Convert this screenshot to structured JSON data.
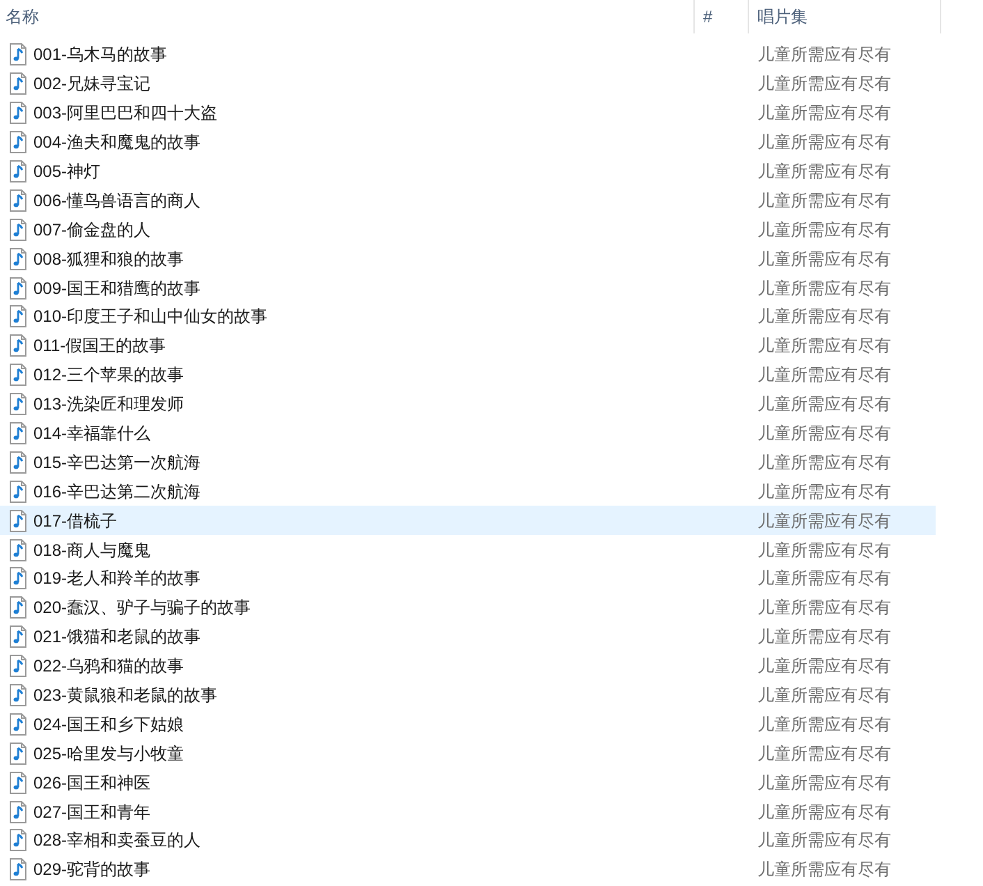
{
  "table": {
    "columns": [
      "名称",
      "#",
      "唱片集"
    ],
    "rows": [
      {
        "name": "001-乌木马的故事",
        "album": "儿童所需应有尽有",
        "selected": false
      },
      {
        "name": "002-兄妹寻宝记",
        "album": "儿童所需应有尽有",
        "selected": false
      },
      {
        "name": "003-阿里巴巴和四十大盗",
        "album": "儿童所需应有尽有",
        "selected": false
      },
      {
        "name": "004-渔夫和魔鬼的故事",
        "album": "儿童所需应有尽有",
        "selected": false
      },
      {
        "name": "005-神灯",
        "album": "儿童所需应有尽有",
        "selected": false
      },
      {
        "name": "006-懂鸟兽语言的商人",
        "album": "儿童所需应有尽有",
        "selected": false
      },
      {
        "name": "007-偷金盘的人",
        "album": "儿童所需应有尽有",
        "selected": false
      },
      {
        "name": "008-狐狸和狼的故事",
        "album": "儿童所需应有尽有",
        "selected": false
      },
      {
        "name": "009-国王和猎鹰的故事",
        "album": "儿童所需应有尽有",
        "selected": false
      },
      {
        "name": "010-印度王子和山中仙女的故事",
        "album": "儿童所需应有尽有",
        "selected": false
      },
      {
        "name": "011-假国王的故事",
        "album": "儿童所需应有尽有",
        "selected": false
      },
      {
        "name": "012-三个苹果的故事",
        "album": "儿童所需应有尽有",
        "selected": false
      },
      {
        "name": "013-洗染匠和理发师",
        "album": "儿童所需应有尽有",
        "selected": false
      },
      {
        "name": "014-幸福靠什么",
        "album": "儿童所需应有尽有",
        "selected": false
      },
      {
        "name": "015-辛巴达第一次航海",
        "album": "儿童所需应有尽有",
        "selected": false
      },
      {
        "name": "016-辛巴达第二次航海",
        "album": "儿童所需应有尽有",
        "selected": false
      },
      {
        "name": "017-借梳子",
        "album": "儿童所需应有尽有",
        "selected": true
      },
      {
        "name": "018-商人与魔鬼",
        "album": "儿童所需应有尽有",
        "selected": false
      },
      {
        "name": "019-老人和羚羊的故事",
        "album": "儿童所需应有尽有",
        "selected": false
      },
      {
        "name": "020-蠢汉、驴子与骗子的故事",
        "album": "儿童所需应有尽有",
        "selected": false
      },
      {
        "name": "021-饿猫和老鼠的故事",
        "album": "儿童所需应有尽有",
        "selected": false
      },
      {
        "name": "022-乌鸦和猫的故事",
        "album": "儿童所需应有尽有",
        "selected": false
      },
      {
        "name": "023-黄鼠狼和老鼠的故事",
        "album": "儿童所需应有尽有",
        "selected": false
      },
      {
        "name": "024-国王和乡下姑娘",
        "album": "儿童所需应有尽有",
        "selected": false
      },
      {
        "name": "025-哈里发与小牧童",
        "album": "儿童所需应有尽有",
        "selected": false
      },
      {
        "name": "026-国王和神医",
        "album": "儿童所需应有尽有",
        "selected": false
      },
      {
        "name": "027-国王和青年",
        "album": "儿童所需应有尽有",
        "selected": false
      },
      {
        "name": "028-宰相和卖蚕豆的人",
        "album": "儿童所需应有尽有",
        "selected": false
      },
      {
        "name": "029-驼背的故事",
        "album": "儿童所需应有尽有",
        "selected": false
      }
    ]
  }
}
